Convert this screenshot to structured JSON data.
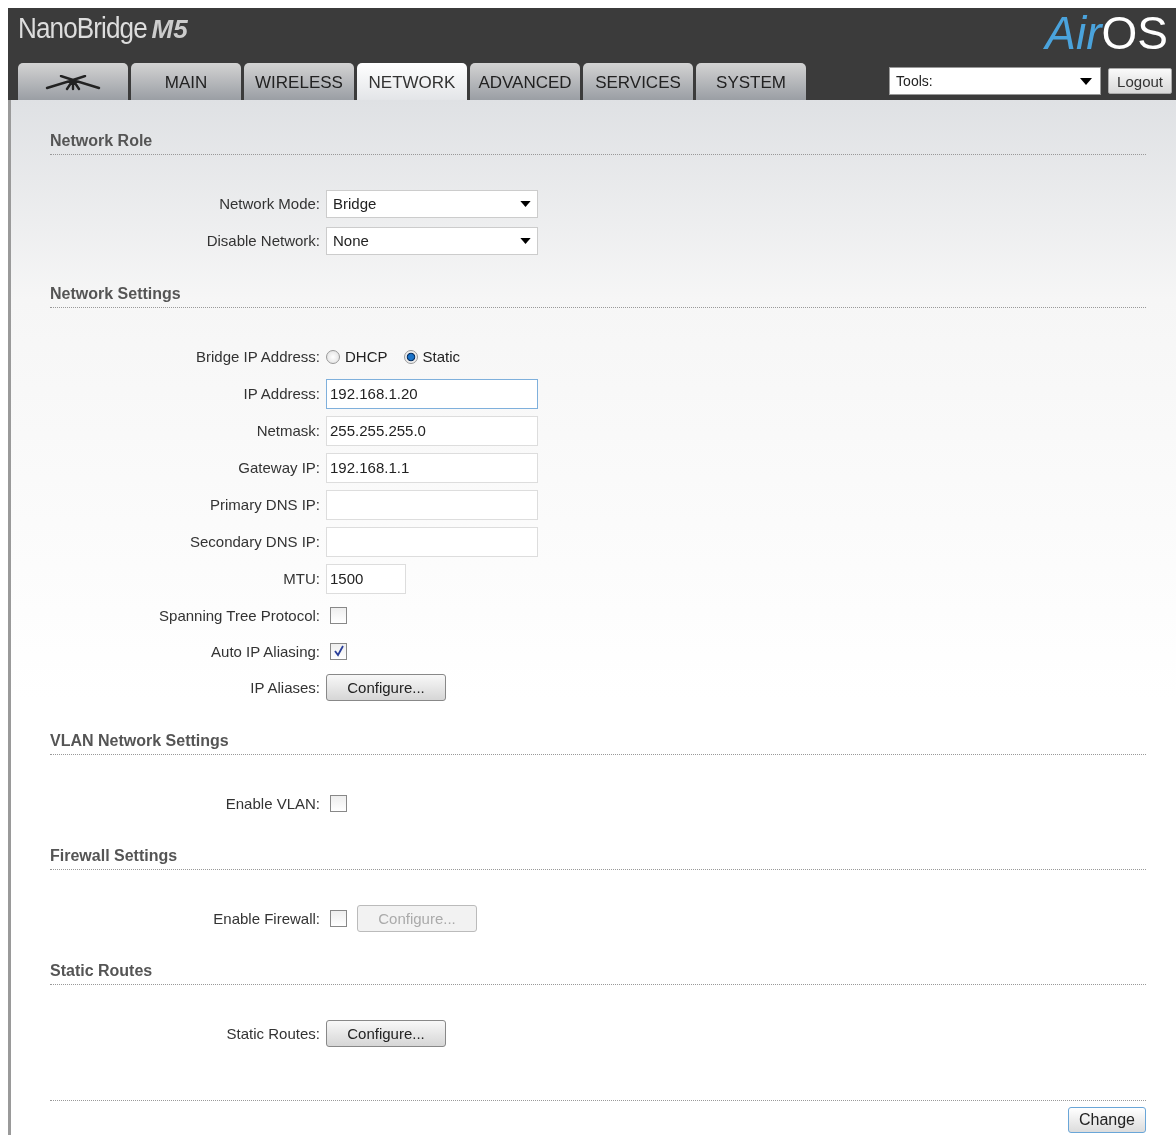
{
  "header": {
    "product": "NanoBridge",
    "model": "M5",
    "logo_left": "Air",
    "logo_right": "OS"
  },
  "tabs": [
    {
      "kind": "icon",
      "selected": false
    },
    {
      "kind": "text",
      "label": "MAIN",
      "selected": false
    },
    {
      "kind": "text",
      "label": "WIRELESS",
      "selected": false
    },
    {
      "kind": "text",
      "label": "NETWORK",
      "selected": true
    },
    {
      "kind": "text",
      "label": "ADVANCED",
      "selected": false
    },
    {
      "kind": "text",
      "label": "SERVICES",
      "selected": false
    },
    {
      "kind": "text",
      "label": "SYSTEM",
      "selected": false
    }
  ],
  "tools": {
    "value": "Tools:"
  },
  "logout": "Logout",
  "sections": [
    {
      "title": "Network Role",
      "rows": [
        {
          "kind": "select",
          "label": "Network Mode:",
          "value": "Bridge"
        },
        {
          "kind": "select",
          "label": "Disable Network:",
          "value": "None"
        }
      ]
    },
    {
      "title": "Network Settings",
      "rows": [
        {
          "kind": "radio",
          "label": "Bridge IP Address:",
          "options": [
            {
              "label": "DHCP",
              "selected": false
            },
            {
              "label": "Static",
              "selected": true
            }
          ]
        },
        {
          "kind": "text",
          "label": "IP Address:",
          "value": "192.168.1.20",
          "focused": true
        },
        {
          "kind": "text",
          "label": "Netmask:",
          "value": "255.255.255.0",
          "focused": false
        },
        {
          "kind": "text",
          "label": "Gateway IP:",
          "value": "192.168.1.1",
          "focused": false
        },
        {
          "kind": "text",
          "label": "Primary DNS IP:",
          "focused": false
        },
        {
          "kind": "text",
          "label": "Secondary DNS IP:",
          "focused": false
        },
        {
          "kind": "short",
          "label": "MTU:",
          "value": "1500",
          "focused": false
        },
        {
          "kind": "checkbox",
          "label": "Spanning Tree Protocol:",
          "checked": false
        },
        {
          "kind": "checkbox",
          "label": "Auto IP Aliasing:",
          "checked": true
        },
        {
          "kind": "button",
          "label": "IP Aliases:",
          "button": "Configure...",
          "disabled": false
        }
      ]
    },
    {
      "title": "VLAN Network Settings",
      "rows": [
        {
          "kind": "checkbox",
          "label": "Enable VLAN:",
          "checked": false
        }
      ]
    },
    {
      "title": "Firewall Settings",
      "rows": [
        {
          "kind": "checkbox_button",
          "label": "Enable Firewall:",
          "checked": false,
          "button": "Configure...",
          "disabled": true
        }
      ]
    },
    {
      "title": "Static Routes",
      "rows": [
        {
          "kind": "button",
          "label": "Static Routes:",
          "button": "Configure...",
          "disabled": false
        }
      ]
    }
  ],
  "change_button": "Change"
}
